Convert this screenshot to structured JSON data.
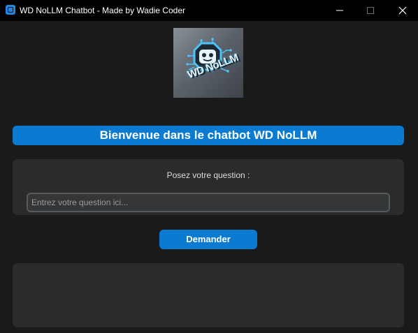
{
  "window": {
    "title": "WD NoLLM Chatbot - Made by Wadie Coder",
    "app_icon": "app-icon",
    "controls": [
      "minimize-icon",
      "maximize-icon",
      "close-icon"
    ]
  },
  "logo": {
    "text": "WD NoLLM",
    "icon": "robot-icon"
  },
  "banner": {
    "text": "Bienvenue dans le chatbot WD NoLLM"
  },
  "question": {
    "label": "Posez votre question :",
    "placeholder": "Entrez votre question ici...",
    "value": ""
  },
  "ask_button": {
    "label": "Demander"
  },
  "response": {
    "text": ""
  },
  "colors": {
    "accent": "#0a7bd1",
    "background": "#1a1a1a",
    "panel": "#2b2b2b",
    "titlebar": "#000000"
  }
}
